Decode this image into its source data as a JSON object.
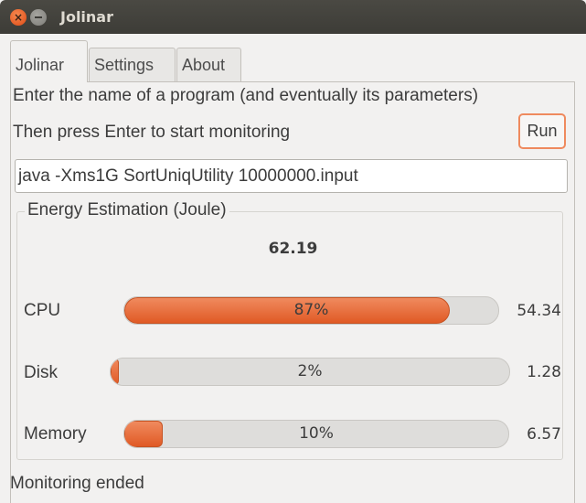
{
  "window": {
    "title": "Jolinar"
  },
  "tabs": [
    {
      "label": "Jolinar",
      "active": true
    },
    {
      "label": "Settings",
      "active": false
    },
    {
      "label": "About",
      "active": false
    }
  ],
  "instructions": {
    "line1": "Enter the name of a program (and eventually its parameters)",
    "line2": "Then press Enter to start monitoring"
  },
  "run_button": {
    "label": "Run"
  },
  "command_input": {
    "value": "java -Xms1G SortUniqUtility 10000000.input"
  },
  "energy": {
    "group_label": "Energy Estimation (Joule)",
    "total": "62.19",
    "rows": [
      {
        "label": "CPU",
        "percent_text": "87%",
        "percent": 87,
        "value": "54.34"
      },
      {
        "label": "Disk",
        "percent_text": "2%",
        "percent": 2,
        "value": "1.28"
      },
      {
        "label": "Memory",
        "percent_text": "10%",
        "percent": 10,
        "value": "6.57"
      }
    ]
  },
  "status": {
    "text": "Monitoring ended"
  },
  "colors": {
    "accent": "#e05a25",
    "titlebar": "#3d3c37",
    "background": "#f2f1f0"
  }
}
